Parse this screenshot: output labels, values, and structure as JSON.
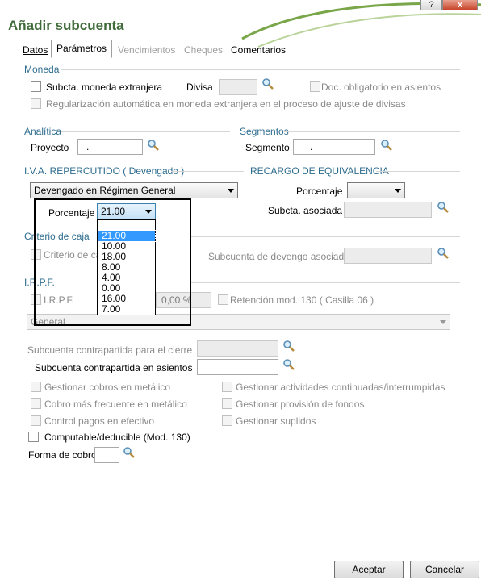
{
  "window": {
    "title": "Añadir subcuenta",
    "help_label": "?",
    "close_label": "x"
  },
  "tabs": [
    {
      "label": "Datos"
    },
    {
      "label": "Parámetros"
    },
    {
      "label": "Vencimientos"
    },
    {
      "label": "Cheques"
    },
    {
      "label": "Comentarios"
    }
  ],
  "moneda": {
    "section": "Moneda",
    "subcta_label": "Subcta. moneda extranjera",
    "divisa_label": "Divisa",
    "doc_label": "Doc. obligatorio en asientos",
    "regularizacion_label": "Regularización automática en moneda extranjera en el proceso de ajuste de divisas"
  },
  "analitica": {
    "section": "Analítica",
    "proyecto_label": "Proyecto",
    "proyecto_value": "."
  },
  "segmentos": {
    "section": "Segmentos",
    "segmento_label": "Segmento",
    "segmento_value": "."
  },
  "iva": {
    "section": "I.V.A. REPERCUTIDO ( Devengado )",
    "regimen": "Devengado en Régimen General",
    "porcentaje_label": "Porcentaje",
    "porcentaje_value": "21.00",
    "options": [
      "21.00",
      "10.00",
      "18.00",
      "8.00",
      "4.00",
      "0.00",
      "16.00",
      "7.00"
    ]
  },
  "recargo": {
    "section": "RECARGO DE EQUIVALENCIA",
    "porcentaje_label": "Porcentaje",
    "subcta_label": "Subcta. asociada"
  },
  "criterio": {
    "section": "Criterio de caja",
    "checkbox_label": "Criterio de caja",
    "devengo_label": "Subcuenta de devengo asociada"
  },
  "irpf": {
    "section": "I.R.P.F.",
    "checkbox_label": "I.R.P.F.",
    "percent_value": "0,00 %",
    "retencion_label": "Retención mod. 130 ( Casilla 06 )",
    "tipo_value": "General"
  },
  "contrapartida": {
    "cierre_label": "Subcuenta contrapartida para el cierre",
    "asientos_label": "Subcuenta contrapartida en asientos"
  },
  "options_left": [
    "Gestionar cobros en metálico",
    "Cobro más frecuente en metálico",
    "Control pagos en efectivo"
  ],
  "options_right": [
    "Gestionar actividades continuadas/interrumpidas",
    "Gestionar provisión de fondos",
    "Gestionar suplidos"
  ],
  "computable_label": "Computable/deducible (Mod. 130)",
  "forma_cobro_label": "Forma de cobro",
  "buttons": {
    "accept": "Aceptar",
    "cancel": "Cancelar"
  },
  "colors": {
    "title_green": "#3f6b3a",
    "section_blue": "#2e6c8e",
    "selection_blue": "#3399ff"
  }
}
